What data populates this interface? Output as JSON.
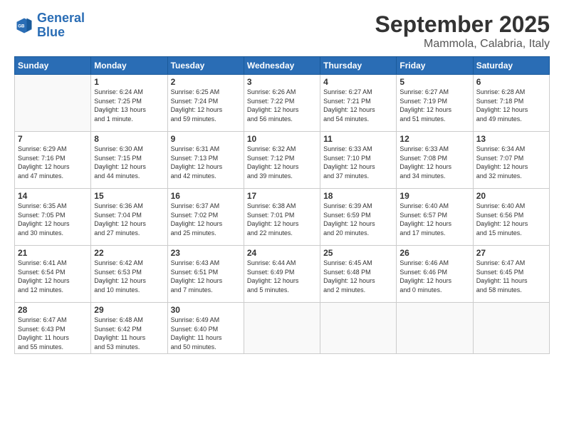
{
  "header": {
    "logo_line1": "General",
    "logo_line2": "Blue",
    "month": "September 2025",
    "location": "Mammola, Calabria, Italy"
  },
  "weekdays": [
    "Sunday",
    "Monday",
    "Tuesday",
    "Wednesday",
    "Thursday",
    "Friday",
    "Saturday"
  ],
  "weeks": [
    [
      {
        "day": "",
        "info": ""
      },
      {
        "day": "1",
        "info": "Sunrise: 6:24 AM\nSunset: 7:25 PM\nDaylight: 13 hours\nand 1 minute."
      },
      {
        "day": "2",
        "info": "Sunrise: 6:25 AM\nSunset: 7:24 PM\nDaylight: 12 hours\nand 59 minutes."
      },
      {
        "day": "3",
        "info": "Sunrise: 6:26 AM\nSunset: 7:22 PM\nDaylight: 12 hours\nand 56 minutes."
      },
      {
        "day": "4",
        "info": "Sunrise: 6:27 AM\nSunset: 7:21 PM\nDaylight: 12 hours\nand 54 minutes."
      },
      {
        "day": "5",
        "info": "Sunrise: 6:27 AM\nSunset: 7:19 PM\nDaylight: 12 hours\nand 51 minutes."
      },
      {
        "day": "6",
        "info": "Sunrise: 6:28 AM\nSunset: 7:18 PM\nDaylight: 12 hours\nand 49 minutes."
      }
    ],
    [
      {
        "day": "7",
        "info": "Sunrise: 6:29 AM\nSunset: 7:16 PM\nDaylight: 12 hours\nand 47 minutes."
      },
      {
        "day": "8",
        "info": "Sunrise: 6:30 AM\nSunset: 7:15 PM\nDaylight: 12 hours\nand 44 minutes."
      },
      {
        "day": "9",
        "info": "Sunrise: 6:31 AM\nSunset: 7:13 PM\nDaylight: 12 hours\nand 42 minutes."
      },
      {
        "day": "10",
        "info": "Sunrise: 6:32 AM\nSunset: 7:12 PM\nDaylight: 12 hours\nand 39 minutes."
      },
      {
        "day": "11",
        "info": "Sunrise: 6:33 AM\nSunset: 7:10 PM\nDaylight: 12 hours\nand 37 minutes."
      },
      {
        "day": "12",
        "info": "Sunrise: 6:33 AM\nSunset: 7:08 PM\nDaylight: 12 hours\nand 34 minutes."
      },
      {
        "day": "13",
        "info": "Sunrise: 6:34 AM\nSunset: 7:07 PM\nDaylight: 12 hours\nand 32 minutes."
      }
    ],
    [
      {
        "day": "14",
        "info": "Sunrise: 6:35 AM\nSunset: 7:05 PM\nDaylight: 12 hours\nand 30 minutes."
      },
      {
        "day": "15",
        "info": "Sunrise: 6:36 AM\nSunset: 7:04 PM\nDaylight: 12 hours\nand 27 minutes."
      },
      {
        "day": "16",
        "info": "Sunrise: 6:37 AM\nSunset: 7:02 PM\nDaylight: 12 hours\nand 25 minutes."
      },
      {
        "day": "17",
        "info": "Sunrise: 6:38 AM\nSunset: 7:01 PM\nDaylight: 12 hours\nand 22 minutes."
      },
      {
        "day": "18",
        "info": "Sunrise: 6:39 AM\nSunset: 6:59 PM\nDaylight: 12 hours\nand 20 minutes."
      },
      {
        "day": "19",
        "info": "Sunrise: 6:40 AM\nSunset: 6:57 PM\nDaylight: 12 hours\nand 17 minutes."
      },
      {
        "day": "20",
        "info": "Sunrise: 6:40 AM\nSunset: 6:56 PM\nDaylight: 12 hours\nand 15 minutes."
      }
    ],
    [
      {
        "day": "21",
        "info": "Sunrise: 6:41 AM\nSunset: 6:54 PM\nDaylight: 12 hours\nand 12 minutes."
      },
      {
        "day": "22",
        "info": "Sunrise: 6:42 AM\nSunset: 6:53 PM\nDaylight: 12 hours\nand 10 minutes."
      },
      {
        "day": "23",
        "info": "Sunrise: 6:43 AM\nSunset: 6:51 PM\nDaylight: 12 hours\nand 7 minutes."
      },
      {
        "day": "24",
        "info": "Sunrise: 6:44 AM\nSunset: 6:49 PM\nDaylight: 12 hours\nand 5 minutes."
      },
      {
        "day": "25",
        "info": "Sunrise: 6:45 AM\nSunset: 6:48 PM\nDaylight: 12 hours\nand 2 minutes."
      },
      {
        "day": "26",
        "info": "Sunrise: 6:46 AM\nSunset: 6:46 PM\nDaylight: 12 hours\nand 0 minutes."
      },
      {
        "day": "27",
        "info": "Sunrise: 6:47 AM\nSunset: 6:45 PM\nDaylight: 11 hours\nand 58 minutes."
      }
    ],
    [
      {
        "day": "28",
        "info": "Sunrise: 6:47 AM\nSunset: 6:43 PM\nDaylight: 11 hours\nand 55 minutes."
      },
      {
        "day": "29",
        "info": "Sunrise: 6:48 AM\nSunset: 6:42 PM\nDaylight: 11 hours\nand 53 minutes."
      },
      {
        "day": "30",
        "info": "Sunrise: 6:49 AM\nSunset: 6:40 PM\nDaylight: 11 hours\nand 50 minutes."
      },
      {
        "day": "",
        "info": ""
      },
      {
        "day": "",
        "info": ""
      },
      {
        "day": "",
        "info": ""
      },
      {
        "day": "",
        "info": ""
      }
    ]
  ]
}
